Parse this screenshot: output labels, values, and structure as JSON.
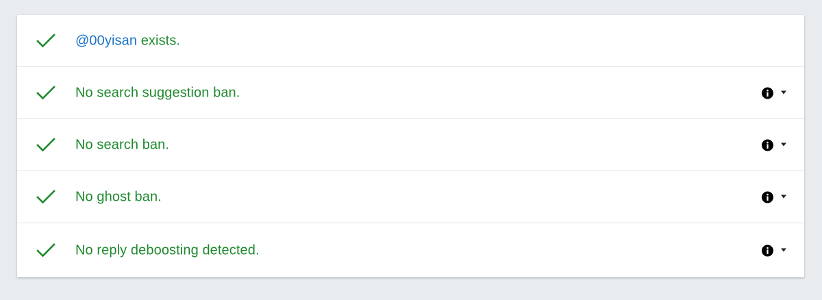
{
  "colors": {
    "success": "#1e8a2d",
    "link": "#1a73c8",
    "background": "#e8ecef",
    "card": "#ffffff",
    "divider": "#e0e0e0"
  },
  "results": [
    {
      "icon": "checkmark-icon",
      "handle": "@00yisan",
      "text": " exists.",
      "has_details": false
    },
    {
      "icon": "checkmark-icon",
      "text": "No search suggestion ban.",
      "has_details": true
    },
    {
      "icon": "checkmark-icon",
      "text": "No search ban.",
      "has_details": true
    },
    {
      "icon": "checkmark-icon",
      "text": "No ghost ban.",
      "has_details": true
    },
    {
      "icon": "checkmark-icon",
      "text": "No reply deboosting detected.",
      "has_details": true
    }
  ]
}
